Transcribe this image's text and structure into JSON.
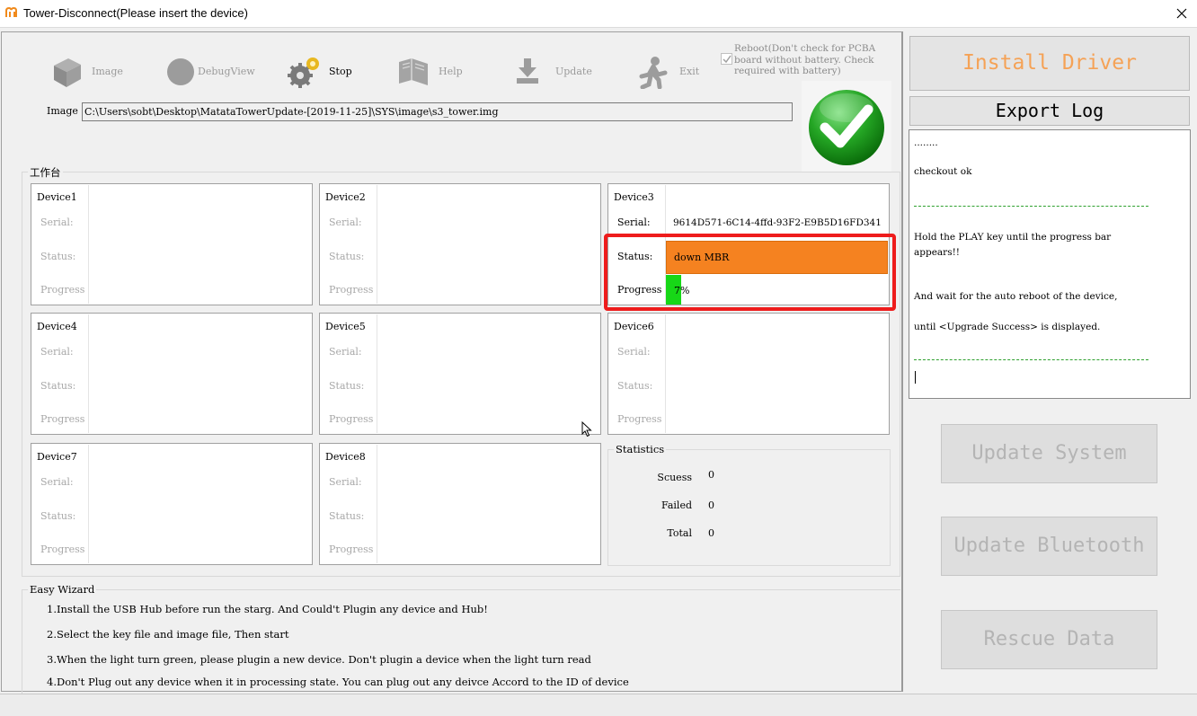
{
  "window": {
    "title": "Tower-Disconnect(Please insert the device)",
    "colors": {
      "accent_orange": "#f58220",
      "progress_green": "#17d717",
      "highlight_red": "#ee1c1c",
      "light_green": "#2aa52a"
    }
  },
  "toolbar": {
    "items": [
      {
        "label": "Image",
        "icon": "image-box-icon",
        "enabled": false
      },
      {
        "label": "DebugView",
        "icon": "debug-circle-icon",
        "enabled": false
      },
      {
        "label": "Stop",
        "icon": "gears-icon",
        "enabled": true
      },
      {
        "label": "Help",
        "icon": "help-book-icon",
        "enabled": false
      },
      {
        "label": "Update",
        "icon": "download-arrow-icon",
        "enabled": false
      },
      {
        "label": "Exit",
        "icon": "running-man-icon",
        "enabled": false
      }
    ],
    "reboot_option": {
      "label": "Reboot(Don't check for PCBA board without battery. Check required with battery)",
      "checked": true
    }
  },
  "image": {
    "label": "Image",
    "path": "C:\\Users\\sobt\\Desktop\\MatataTowerUpdate-[2019-11-25]\\SYS\\image\\s3_tower.img"
  },
  "workbench": {
    "label": "工作台",
    "devices": [
      {
        "name": "Device1",
        "serial_label": "Serial:",
        "status_label": "Status:",
        "progress_label": "Progress"
      },
      {
        "name": "Device2",
        "serial_label": "Serial:",
        "status_label": "Status:",
        "progress_label": "Progress"
      },
      {
        "name": "Device3",
        "serial_label": "Serial:",
        "status_label": "Status:",
        "progress_label": "Progress",
        "serial": "9614D571-6C14-4ffd-93F2-E9B5D16FD341",
        "status": "down MBR",
        "progress_text": "7%",
        "progress": 0.07
      },
      {
        "name": "Device4",
        "serial_label": "Serial:",
        "status_label": "Status:",
        "progress_label": "Progress"
      },
      {
        "name": "Device5",
        "serial_label": "Serial:",
        "status_label": "Status:",
        "progress_label": "Progress"
      },
      {
        "name": "Device6",
        "serial_label": "Serial:",
        "status_label": "Status:",
        "progress_label": "Progress"
      },
      {
        "name": "Device7",
        "serial_label": "Serial:",
        "status_label": "Status:",
        "progress_label": "Progress"
      },
      {
        "name": "Device8",
        "serial_label": "Serial:",
        "status_label": "Status:",
        "progress_label": "Progress"
      }
    ],
    "statistics": {
      "label": "Statistics",
      "rows": [
        {
          "label": "Scuess",
          "value": "0"
        },
        {
          "label": "Failed",
          "value": "0"
        },
        {
          "label": "Total",
          "value": "0"
        }
      ]
    }
  },
  "wizard": {
    "label": "Easy Wizard",
    "steps": [
      "1.Install the USB Hub before run the starg. And Could't Plugin any device and Hub!",
      "2.Select the key file and image file, Then start",
      "3.When the light turn green, please plugin a new device. Don't plugin a device when the light turn read",
      "4.Don't Plug out any device when it in processing state. You can plug out any deivce Accord to the ID of device"
    ]
  },
  "right_panel": {
    "install_driver": "Install Driver",
    "export_log": "Export Log",
    "log": {
      "dots": "........",
      "checkout": "checkout ok",
      "hold_line1": "Hold the PLAY key until the progress bar",
      "hold_line2": "appears!!",
      "wait_line": "And wait for the auto reboot of the device,",
      "until_line": "until <Upgrade Success> is displayed."
    },
    "update_system": "Update System",
    "update_bluetooth": "Update Bluetooth",
    "rescue_data": "Rescue Data"
  }
}
